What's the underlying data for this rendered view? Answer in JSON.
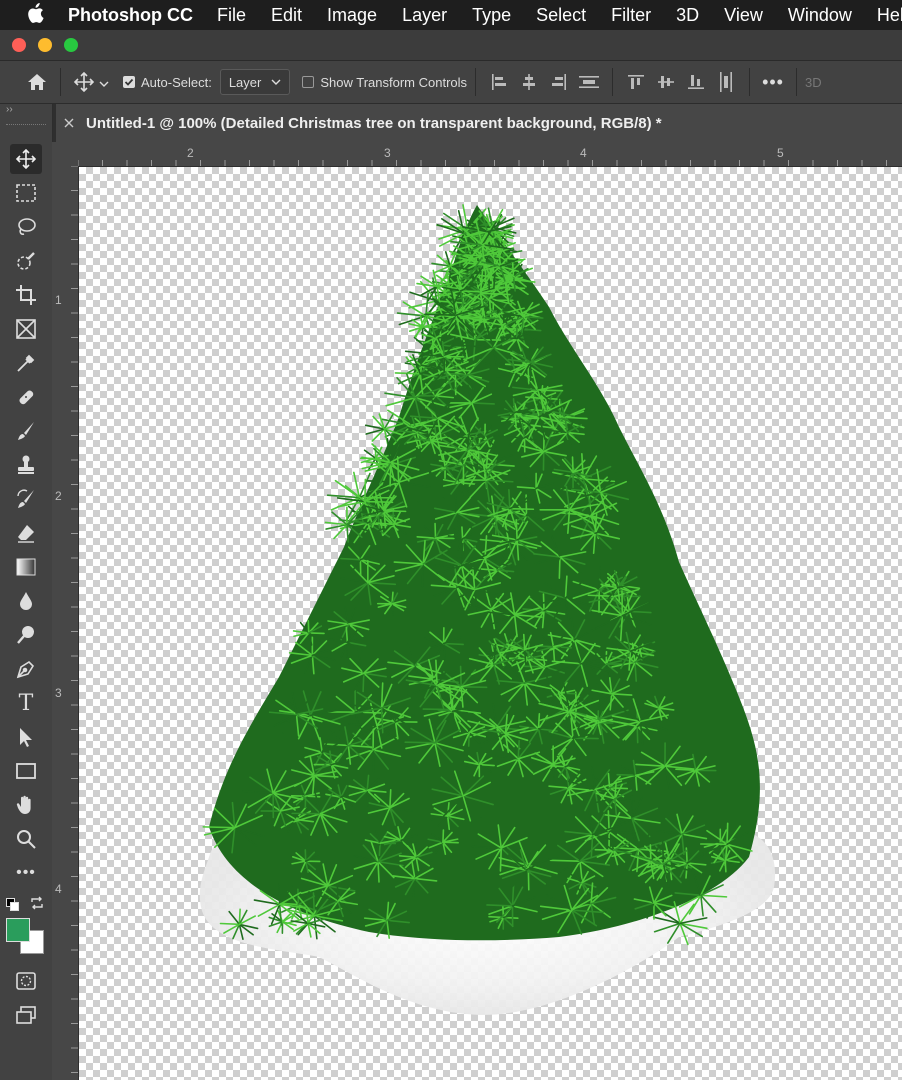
{
  "menubar": {
    "app_name": "Photoshop CC",
    "items": [
      "File",
      "Edit",
      "Image",
      "Layer",
      "Type",
      "Select",
      "Filter",
      "3D",
      "View",
      "Window",
      "Help"
    ]
  },
  "options_bar": {
    "auto_select_label": "Auto-Select:",
    "auto_select_checked": true,
    "auto_select_value": "Layer",
    "show_transform_label": "Show Transform Controls",
    "show_transform_checked": false,
    "three_d_label": "3D"
  },
  "document_tab": {
    "title": "Untitled-1 @ 100% (Detailed Christmas tree on transparent background, RGB/8) *"
  },
  "ruler_top": {
    "labels": [
      "2",
      "3",
      "4",
      "5"
    ]
  },
  "ruler_left": {
    "labels": [
      "1",
      "2",
      "3",
      "4"
    ]
  },
  "colors": {
    "foreground": "#2a9d5c",
    "background": "#ffffff",
    "tree_dark": "#1f6b1e",
    "tree_light": "#4fc93a"
  },
  "tools": [
    "move-tool",
    "marquee-tool",
    "lasso-tool",
    "quick-selection-tool",
    "crop-tool",
    "frame-tool",
    "eyedropper-tool",
    "healing-brush-tool",
    "brush-tool",
    "clone-stamp-tool",
    "history-brush-tool",
    "eraser-tool",
    "gradient-tool",
    "blur-tool",
    "dodge-tool",
    "pen-tool",
    "type-tool",
    "path-selection-tool",
    "rectangle-tool",
    "hand-tool",
    "zoom-tool",
    "more-tools"
  ]
}
